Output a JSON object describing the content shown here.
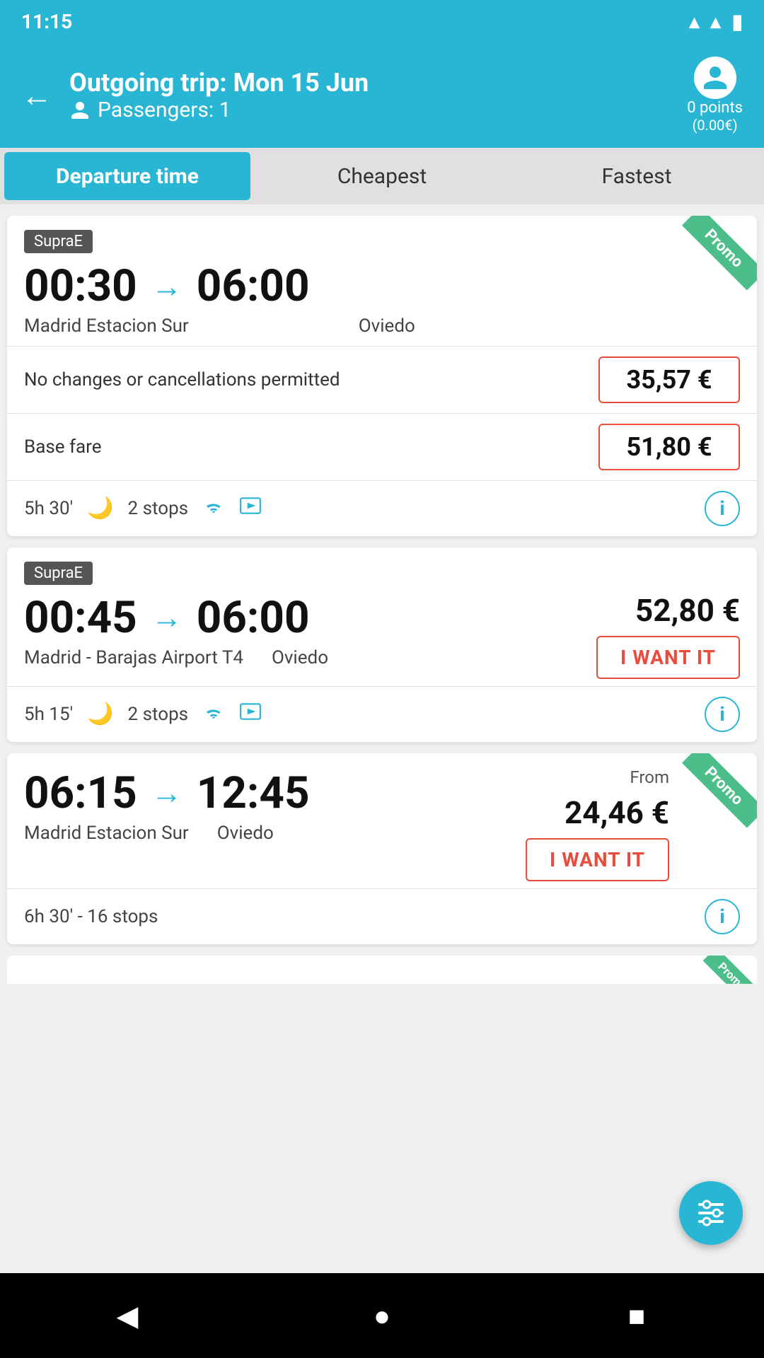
{
  "statusBar": {
    "time": "11:15"
  },
  "header": {
    "backLabel": "←",
    "title": "Outgoing trip: Mon 15 Jun",
    "subtitle": "Passengers: 1",
    "userPoints": "0 points",
    "userPointsAmount": "(0.00€)"
  },
  "sortTabs": {
    "tab1": "Departure time",
    "tab2": "Cheapest",
    "tab3": "Fastest"
  },
  "cards": [
    {
      "badge": "SupraE",
      "departureTime": "00:30",
      "arrivalTime": "06:00",
      "fromLocation": "Madrid Estacion Sur",
      "toLocation": "Oviedo",
      "promoLabel": "Promo",
      "fareLabel": "No changes or cancellations permitted",
      "farePrice": "35,57 €",
      "baseFareLabel": "Base fare",
      "baseFarePrice": "51,80 €",
      "duration": "5h 30'",
      "stops": "2 stops"
    },
    {
      "badge": "SupraE",
      "departureTime": "00:45",
      "arrivalTime": "06:00",
      "fromLocation": "Madrid - Barajas Airport T4",
      "toLocation": "Oviedo",
      "price": "52,80 €",
      "wantItLabel": "I WANT IT",
      "duration": "5h 15'",
      "stops": "2 stops"
    },
    {
      "departureTime": "06:15",
      "arrivalTime": "12:45",
      "fromLocation": "Madrid Estacion Sur",
      "toLocation": "Oviedo",
      "fromLabel": "From",
      "price": "24,46 €",
      "promoLabel": "Promo",
      "wantItLabel": "I WANT IT",
      "duration": "6h 30' - 16 stops"
    }
  ],
  "filterFabLabel": "filter",
  "navBar": {
    "back": "◀",
    "home": "●",
    "square": "■"
  }
}
